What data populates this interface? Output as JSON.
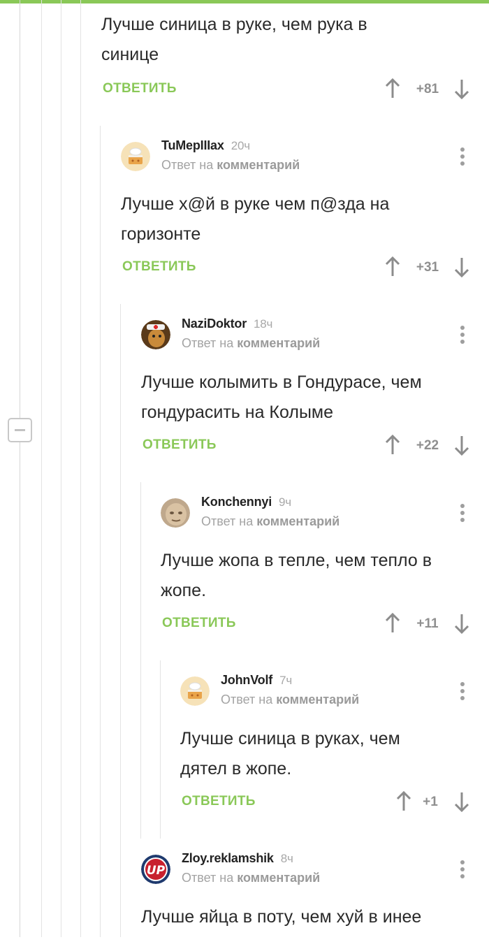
{
  "reply_label": "ОТВЕТИТЬ",
  "reply_prefix": "Ответ на",
  "reply_target": "комментарий",
  "colors": {
    "accent": "#8ac858",
    "muted": "#a3a3a3"
  },
  "top_comment": {
    "text_line1": "Лучше синица в руке, чем рука в",
    "text_line2": "синице",
    "score": "+81"
  },
  "comments": [
    {
      "author": "TuMepIIIax",
      "time": "20ч",
      "text_line1": "Лучше х@й в руке чем п@зда на",
      "text_line2": "горизонте",
      "score": "+31",
      "avatar": "cake-avatar"
    },
    {
      "author": "NaziDoktor",
      "time": "18ч",
      "text_line1": "Лучше колымить в Гондурасе, чем",
      "text_line2": "гондурасить на Колыме",
      "score": "+22",
      "avatar": "doctor-avatar"
    },
    {
      "author": "Konchennyi",
      "time": "9ч",
      "text_line1": "Лучше жопа в тепле, чем тепло в",
      "text_line2": "жопе.",
      "score": "+11",
      "avatar": "face-avatar"
    },
    {
      "author": "JohnVolf",
      "time": "7ч",
      "text_line1": "Лучше синица в руках, чем",
      "text_line2": "дятел в жопе.",
      "score": "+1",
      "avatar": "cake-avatar"
    },
    {
      "author": "Zloy.reklamshik",
      "time": "8ч",
      "text_line1": "Лучше яйца в поту, чем хуй в инее",
      "avatar": "up-logo-avatar"
    }
  ]
}
